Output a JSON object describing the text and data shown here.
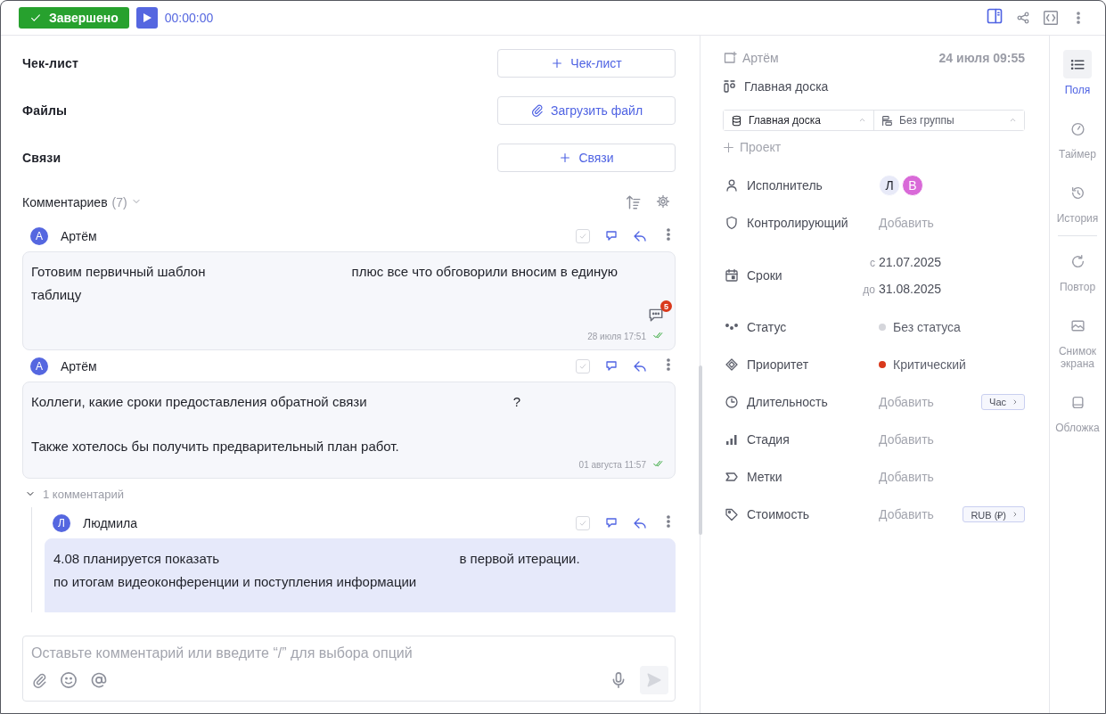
{
  "topbar": {
    "status_button": {
      "label": "Завершено",
      "done": true
    },
    "timer": "00:00:00"
  },
  "sections": [
    {
      "label": "Чек-лист",
      "button": "Чек-лист",
      "kind": "add"
    },
    {
      "label": "Файлы",
      "button": "Загрузить файл",
      "kind": "upload"
    },
    {
      "label": "Связи",
      "button": "Связи",
      "kind": "add"
    }
  ],
  "comments_header": {
    "label": "Комментариев",
    "count": "(7)"
  },
  "comments": [
    {
      "author": "Артём",
      "initial": "А",
      "resolved": false,
      "paragraphs": [
        [
          "Готовим первичный шаблон",
          "плюс все что обговорили вносим в единую таблицу"
        ]
      ],
      "replies_badge": "5",
      "time": "28 июля 17:51",
      "read": true
    },
    {
      "author": "Артём",
      "initial": "А",
      "resolved": false,
      "paragraphs": [
        [
          "Коллеги, какие сроки предоставления обратной связи",
          "?"
        ],
        [
          "Также хотелось бы получить предварительный план работ."
        ]
      ],
      "time": "01 августа 11:57",
      "read": true,
      "thread": {
        "label": "1 комментарий",
        "expanded": true,
        "children": [
          {
            "author": "Людмила",
            "initial": "Л",
            "resolved": false,
            "paragraphs": [
              [
                "4.08 планируется показать",
                "в первой итерации."
              ],
              [
                "по итогам видеоконференции и поступления информации"
              ]
            ]
          }
        ]
      }
    }
  ],
  "composer": {
    "placeholder": "Оставьте комментарий или введите “/” для выбора опций"
  },
  "details": {
    "creator": "Артём",
    "created": "24 июля 09:55",
    "board": "Главная доска",
    "selects": [
      "Главная доска",
      "Без группы"
    ],
    "add_project": "Проект",
    "fields": [
      {
        "kind": "people",
        "label": "Исполнитель",
        "people": [
          {
            "initial": "Л",
            "color": "#e8eaf8"
          },
          {
            "initial": "В",
            "color": "#d96ad8"
          }
        ]
      },
      {
        "kind": "add",
        "label": "Контролирующий",
        "value": "Добавить"
      },
      {
        "kind": "dates",
        "label": "Сроки",
        "from_prefix": "с",
        "from": "21.07.2025",
        "to_prefix": "до",
        "to": "31.08.2025"
      },
      {
        "kind": "dot",
        "label": "Статус",
        "value": "Без статуса",
        "color": "#d5d6db"
      },
      {
        "kind": "dot",
        "label": "Приоритет",
        "value": "Критический",
        "color": "#d9391c"
      },
      {
        "kind": "add",
        "label": "Длительность",
        "value": "Добавить",
        "chip": "Час"
      },
      {
        "kind": "add",
        "label": "Стадия",
        "value": "Добавить"
      },
      {
        "kind": "add",
        "label": "Метки",
        "value": "Добавить"
      },
      {
        "kind": "add",
        "label": "Стоимость",
        "value": "Добавить",
        "chip": "RUB (₽)"
      }
    ]
  },
  "side_tabs": [
    {
      "label": "Поля",
      "selected": true
    },
    {
      "label": "Таймер",
      "selected": false
    },
    {
      "label": "История",
      "selected": false
    },
    {
      "label": "Повтор",
      "selected": false
    },
    {
      "label": "Снимок экрана",
      "selected": false
    },
    {
      "label": "Обложка",
      "selected": false
    }
  ]
}
